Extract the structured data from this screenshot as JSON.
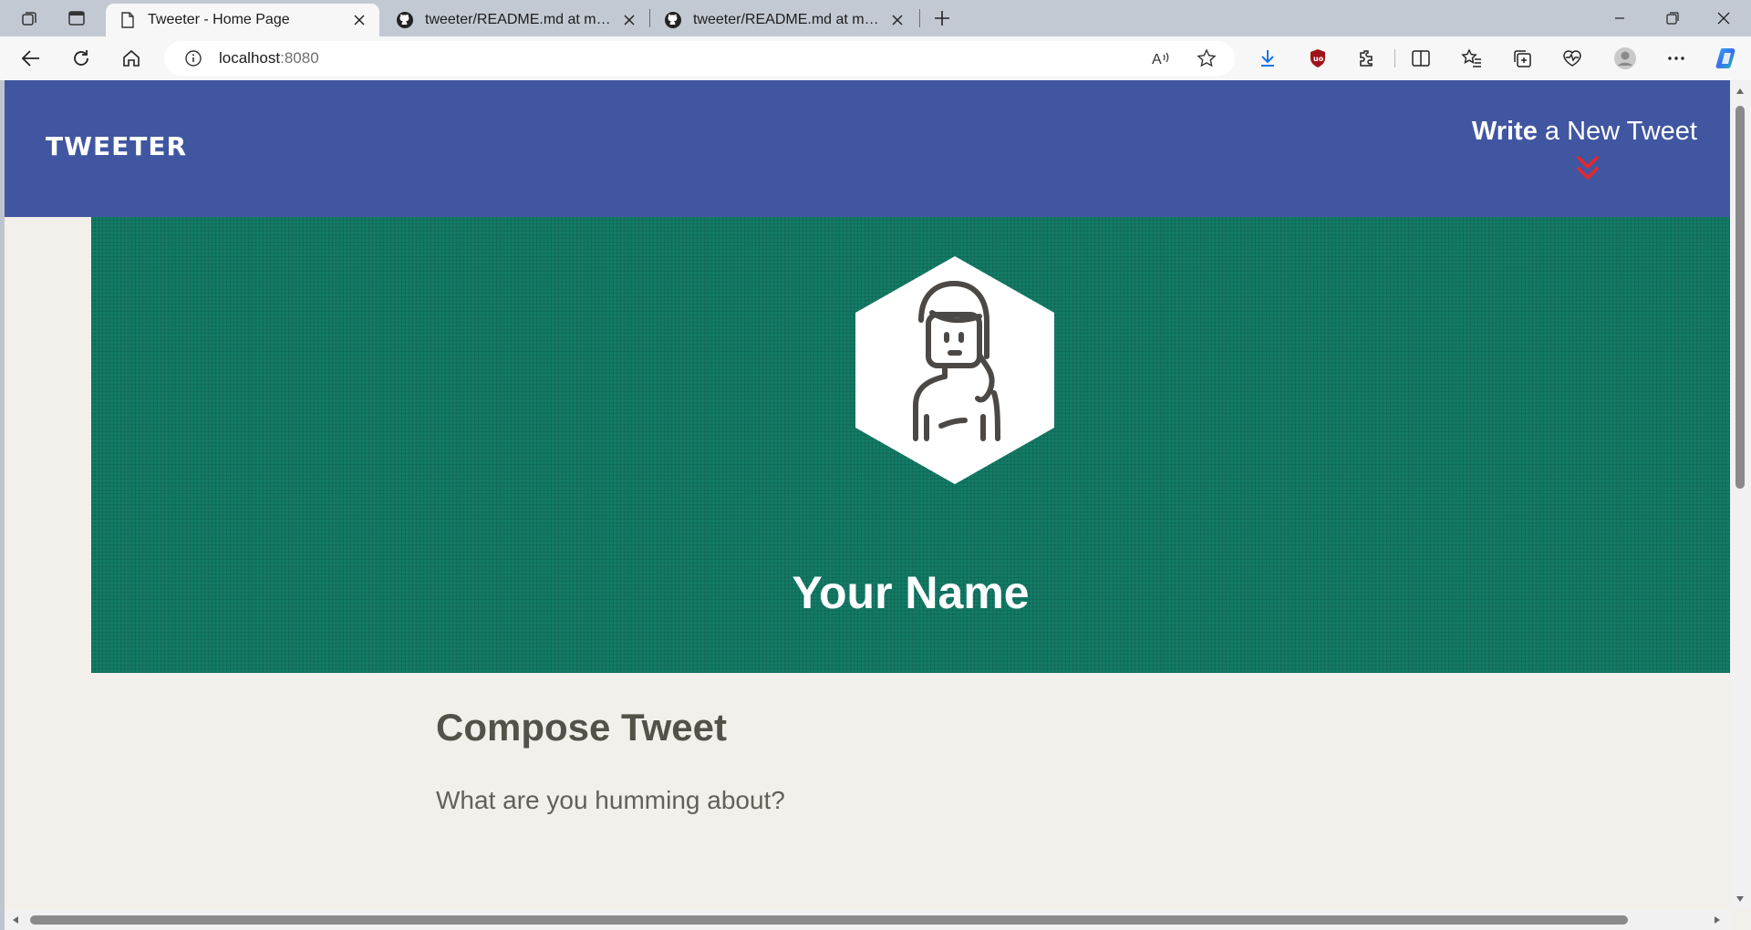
{
  "browser": {
    "tabs": [
      {
        "title": "Tweeter - Home Page",
        "icon": "page-icon",
        "active": true
      },
      {
        "title": "tweeter/README.md at master ·",
        "icon": "github-icon",
        "active": false
      },
      {
        "title": "tweeter/README.md at master ·",
        "icon": "github-icon",
        "active": false
      }
    ],
    "address": {
      "host": "localhost",
      "port": ":8080"
    }
  },
  "app": {
    "logo": "TWEETER",
    "compose_link": {
      "bold": "Write",
      "rest": " a New Tweet"
    },
    "profile": {
      "name": "Your Name"
    },
    "compose": {
      "title": "Compose Tweet",
      "placeholder": "What are you humming about?"
    }
  },
  "colors": {
    "header": "#4056a1",
    "banner": "#137b65",
    "page_bg": "#f3f0eb",
    "text": "#545149",
    "accent_chevron": "#e8262b"
  }
}
